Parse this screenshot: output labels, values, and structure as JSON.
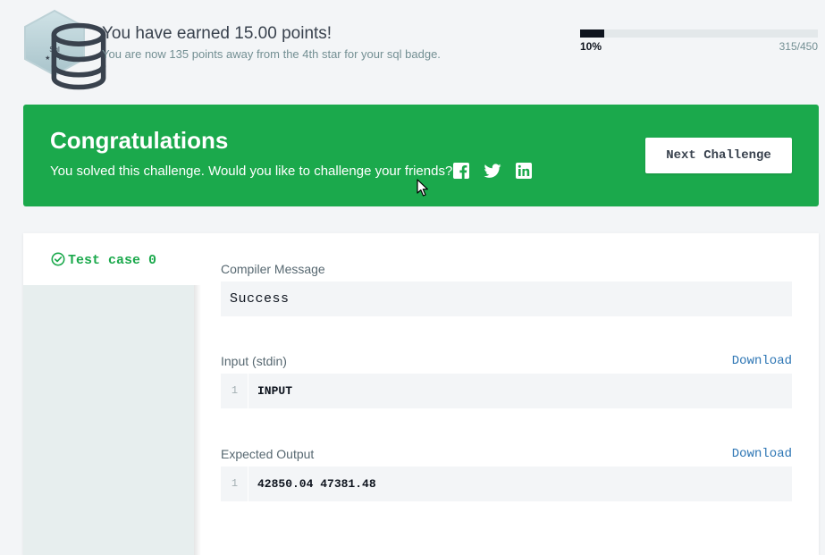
{
  "points": {
    "badge": {
      "icon": "database-icon",
      "label": "Sql",
      "stars": "★★★"
    },
    "title": "You have earned 15.00 points!",
    "subtitle": "You are now 135 points away from the 4th star for your sql badge.",
    "progress": {
      "percent_label": "10%",
      "fraction": 0.1,
      "count_label": "315/450"
    }
  },
  "congrats": {
    "title": "Congratulations",
    "message": "You solved this challenge. Would you like to challenge your friends?",
    "share_icons": [
      "facebook-icon",
      "twitter-icon",
      "linkedin-icon"
    ],
    "next_button": "Next Challenge",
    "color": "#1ba94c"
  },
  "results": {
    "tabs": [
      {
        "label": "Test case 0",
        "status": "passed",
        "icon": "check-circle-icon"
      }
    ],
    "compiler": {
      "label": "Compiler Message",
      "value": "Success"
    },
    "input": {
      "label": "Input (stdin)",
      "download": "Download",
      "lines": [
        {
          "number": "1",
          "text": "INPUT"
        }
      ]
    },
    "expected": {
      "label": "Expected Output",
      "download": "Download",
      "lines": [
        {
          "number": "1",
          "text": "42850.04 47381.48"
        }
      ]
    }
  },
  "colors": {
    "success_green": "#1ba94c",
    "link_blue": "#2c75b4",
    "text_dark": "#39424e",
    "progress_dark": "#0e141e"
  }
}
